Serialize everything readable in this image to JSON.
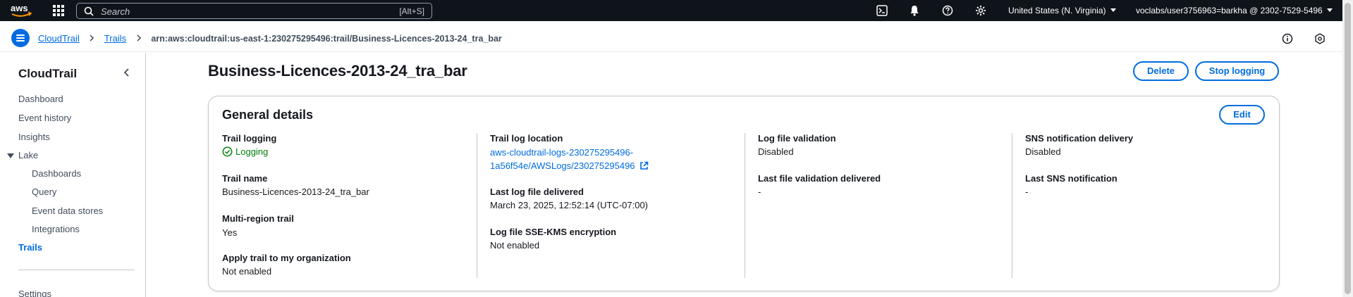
{
  "topnav": {
    "logo_text": "aws",
    "search_placeholder": "Search",
    "search_shortcut": "[Alt+S]",
    "region": "United States (N. Virginia)",
    "account": "voclabs/user3756963=barkha @ 2302-7529-5496",
    "icons": [
      "cloudshell-icon",
      "bell-icon",
      "help-icon",
      "gear-icon"
    ]
  },
  "breadcrumb": {
    "items": [
      "CloudTrail",
      "Trails"
    ],
    "current": "arn:aws:cloudtrail:us-east-1:230275295496:trail/Business-Licences-2013-24_tra_bar"
  },
  "sidebar": {
    "title": "CloudTrail",
    "items": [
      "Dashboard",
      "Event history",
      "Insights"
    ],
    "lake": {
      "label": "Lake",
      "children": [
        "Dashboards",
        "Query",
        "Event data stores",
        "Integrations"
      ]
    },
    "trails": "Trails",
    "settings": "Settings"
  },
  "page": {
    "title": "Business-Licences-2013-24_tra_bar",
    "delete_label": "Delete",
    "stop_label": "Stop logging"
  },
  "general": {
    "title": "General details",
    "edit_label": "Edit",
    "col1": [
      {
        "label": "Trail logging",
        "value": "Logging"
      },
      {
        "label": "Trail name",
        "value": "Business-Licences-2013-24_tra_bar"
      },
      {
        "label": "Multi-region trail",
        "value": "Yes"
      },
      {
        "label": "Apply trail to my organization",
        "value": "Not enabled"
      }
    ],
    "col2": [
      {
        "label": "Trail log location",
        "value_line1": "aws-cloudtrail-logs-230275295496-",
        "value_line2": "1a56f54e/AWSLogs/230275295496"
      },
      {
        "label": "Last log file delivered",
        "value": "March 23, 2025, 12:52:14 (UTC-07:00)"
      },
      {
        "label": "Log file SSE-KMS encryption",
        "value": "Not enabled"
      }
    ],
    "col3": [
      {
        "label": "Log file validation",
        "value": "Disabled"
      },
      {
        "label": "Last file validation delivered",
        "value": "-"
      }
    ],
    "col4": [
      {
        "label": "SNS notification delivery",
        "value": "Disabled"
      },
      {
        "label": "Last SNS notification",
        "value": "-"
      }
    ]
  },
  "colors": {
    "topnav_bg": "#0f141a",
    "link": "#006ce0",
    "success": "#037f0c",
    "text": "#16191f"
  }
}
